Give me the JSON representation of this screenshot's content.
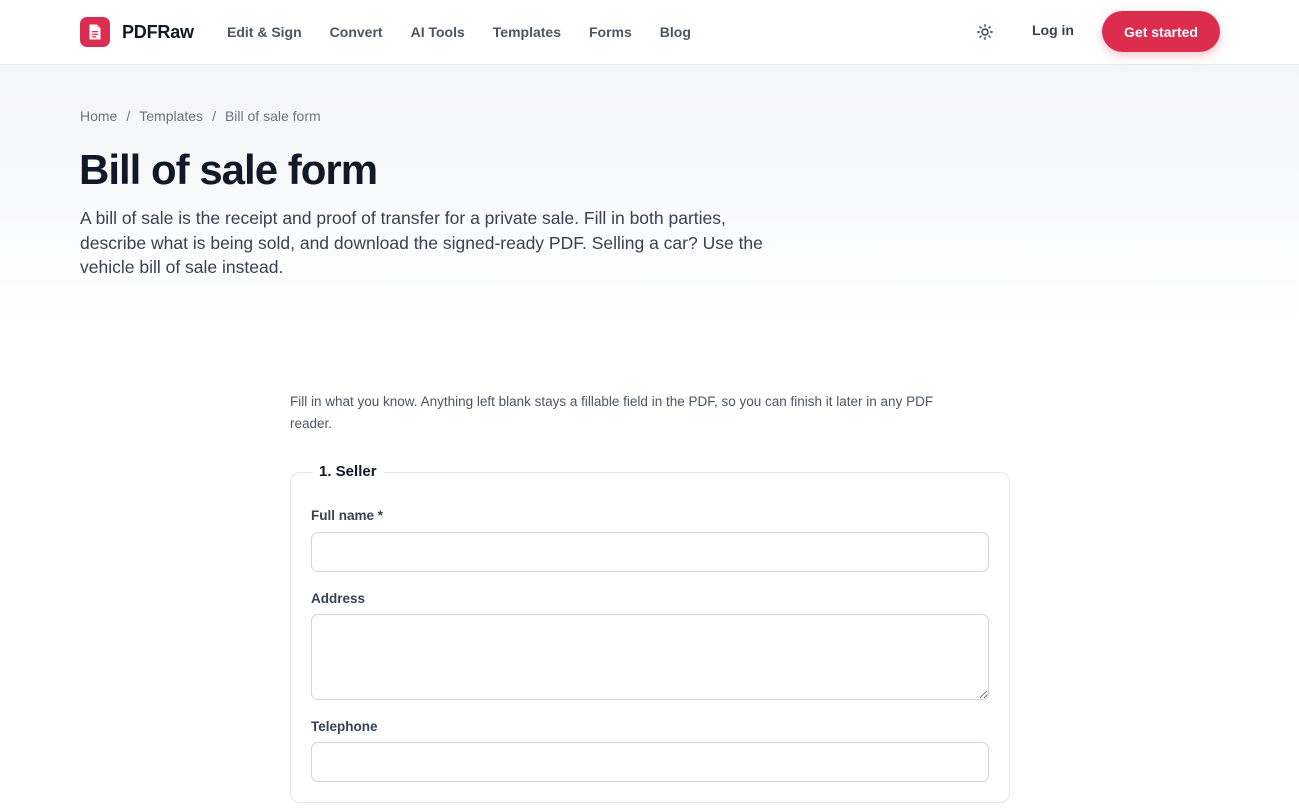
{
  "brand": {
    "name": "PDFRaw",
    "icon": "document-icon",
    "accent": "#dc2d4f"
  },
  "nav": {
    "items": [
      "Edit & Sign",
      "Convert",
      "AI Tools",
      "Templates",
      "Forms",
      "Blog"
    ]
  },
  "header": {
    "theme_icon": "sun-icon",
    "login_label": "Log in",
    "cta_label": "Get started"
  },
  "breadcrumb": {
    "items": [
      "Home",
      "Templates",
      "Bill of sale form"
    ],
    "separator": "/"
  },
  "page": {
    "title": "Bill of sale form",
    "description": "A bill of sale is the receipt and proof of transfer for a private sale. Fill in both parties, describe what is being sold, and download the signed-ready PDF. Selling a car? Use the vehicle bill of sale instead."
  },
  "form": {
    "intro": "Fill in what you know. Anything left blank stays a fillable field in the PDF, so you can finish it later in any PDF reader.",
    "sections": [
      {
        "legend": "1. Seller",
        "fields": [
          {
            "label": "Full name *",
            "value": "",
            "placeholder": ""
          },
          {
            "label": "Address",
            "value": "",
            "placeholder": ""
          },
          {
            "label": "Telephone",
            "value": "",
            "placeholder": ""
          }
        ]
      }
    ]
  }
}
